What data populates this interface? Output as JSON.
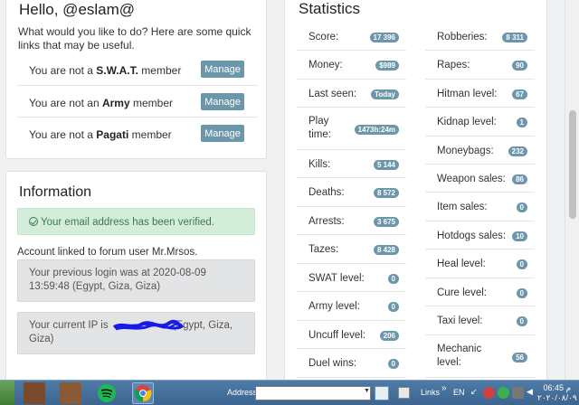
{
  "hello": {
    "title": "Hello, @eslam@",
    "desc": "What would you like to do? Here are some quick links that may be useful.",
    "memberships": [
      {
        "prefix": "You are not a ",
        "org": "S.W.A.T.",
        "suffix": " member",
        "button": "Manage"
      },
      {
        "prefix": "You are not an ",
        "org": "Army",
        "suffix": " member",
        "button": "Manage"
      },
      {
        "prefix": "You are not a ",
        "org": "Pagati",
        "suffix": " member",
        "button": "Manage"
      }
    ]
  },
  "info": {
    "title": "Information",
    "verified": "Your email address has been verified.",
    "linked": "Account linked to forum user Mr.Mrsos.",
    "previous_login": "Your previous login was at 2020-08-09 13:59:48 (Egypt, Giza, Giza)",
    "ip_prefix": "Your current IP is",
    "ip_suffix": "(Egypt, Giza, Giza)"
  },
  "stats": {
    "title": "Statistics",
    "left": [
      {
        "label": "Score:",
        "value": "17 396"
      },
      {
        "label": "Money:",
        "value": "$989"
      },
      {
        "label": "Last seen:",
        "value": "Today"
      },
      {
        "label": "Play time:",
        "value": "1473h:24m"
      },
      {
        "label": "Kills:",
        "value": "5 144"
      },
      {
        "label": "Deaths:",
        "value": "8 572"
      },
      {
        "label": "Arrests:",
        "value": "3 675"
      },
      {
        "label": "Tazes:",
        "value": "8 428"
      },
      {
        "label": "SWAT level:",
        "value": "0"
      },
      {
        "label": "Army level:",
        "value": "0"
      },
      {
        "label": "Uncuff level:",
        "value": "206"
      },
      {
        "label": "Duel wins:",
        "value": "0"
      }
    ],
    "right": [
      {
        "label": "Robberies:",
        "value": "8 311"
      },
      {
        "label": "Rapes:",
        "value": "90"
      },
      {
        "label": "Hitman level:",
        "value": "67"
      },
      {
        "label": "Kidnap level:",
        "value": "1"
      },
      {
        "label": "Moneybags:",
        "value": "232"
      },
      {
        "label": "Weapon sales:",
        "value": "86"
      },
      {
        "label": "Item sales:",
        "value": "0"
      },
      {
        "label": "Hotdogs sales:",
        "value": "10"
      },
      {
        "label": "Heal level:",
        "value": "0"
      },
      {
        "label": "Cure level:",
        "value": "0"
      },
      {
        "label": "Taxi level:",
        "value": "0"
      },
      {
        "label": "Mechanic level:",
        "value": "56"
      }
    ]
  },
  "taskbar": {
    "address_label": "Address",
    "links_label": "Links",
    "lang": "EN",
    "time": "06:45 م",
    "date": "٢٠٢٠/٠٨/٠٩",
    "apps": [
      "game-app-icon",
      "game-app-icon-2",
      "spotify-icon",
      "chrome-icon"
    ]
  }
}
